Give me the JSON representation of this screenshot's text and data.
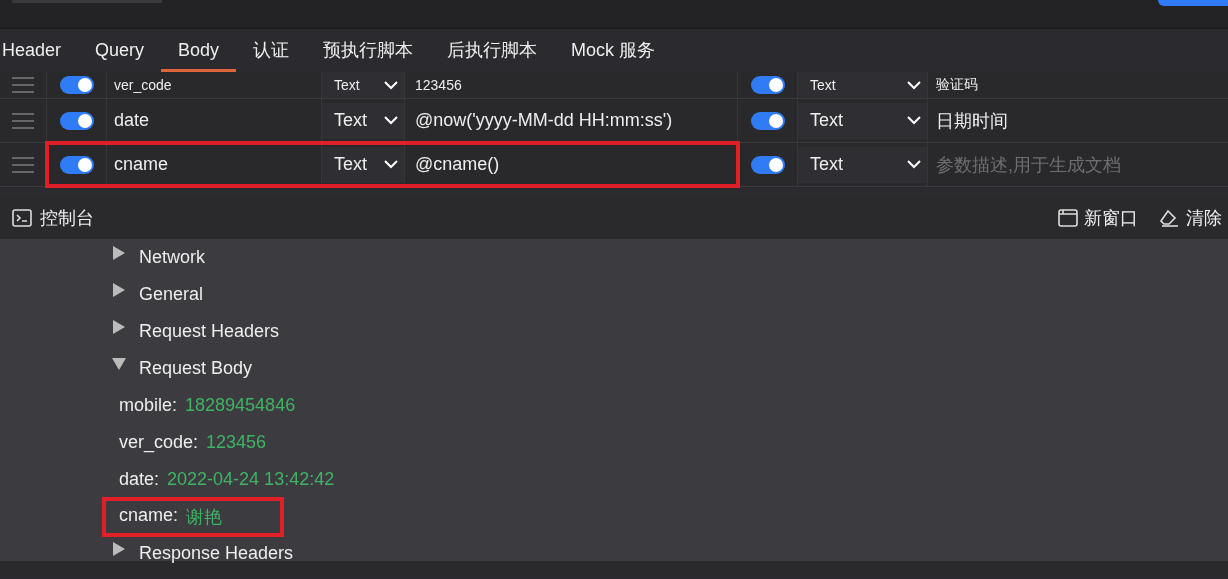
{
  "tabs": [
    {
      "label": "Header",
      "selected": false
    },
    {
      "label": "Query",
      "selected": false
    },
    {
      "label": "Body",
      "selected": true
    },
    {
      "label": "认证",
      "selected": false
    },
    {
      "label": "预执行脚本",
      "selected": false
    },
    {
      "label": "后执行脚本",
      "selected": false
    },
    {
      "label": "Mock 服务",
      "selected": false
    }
  ],
  "params": [
    {
      "enabled": true,
      "name": "ver_code",
      "type": "Text",
      "value": "123456",
      "desc_enabled": true,
      "desc_type": "Text",
      "description": "验证码",
      "partial": true,
      "highlighted": false
    },
    {
      "enabled": true,
      "name": "date",
      "type": "Text",
      "value": "@now('yyyy-MM-dd HH:mm:ss')",
      "desc_enabled": true,
      "desc_type": "Text",
      "description": "日期时间",
      "partial": false,
      "highlighted": false
    },
    {
      "enabled": true,
      "name": "cname",
      "type": "Text",
      "value": "@cname()",
      "desc_enabled": true,
      "desc_type": "Text",
      "placeholder": "参数描述,用于生成文档",
      "partial": false,
      "highlighted": true
    }
  ],
  "console": {
    "title": "控制台",
    "actions": [
      {
        "kind": "window",
        "label": "新窗口"
      },
      {
        "kind": "clear",
        "label": "清除"
      }
    ],
    "entries": [
      {
        "kind": "section",
        "label": "Network",
        "expanded": false
      },
      {
        "kind": "section",
        "label": "General",
        "expanded": false
      },
      {
        "kind": "section",
        "label": "Request Headers",
        "expanded": false
      },
      {
        "kind": "section",
        "label": "Request Body",
        "expanded": true
      },
      {
        "kind": "field",
        "key": "mobile:",
        "value": "18289454846",
        "highlighted": false
      },
      {
        "kind": "field",
        "key": "ver_code:",
        "value": "123456",
        "highlighted": false
      },
      {
        "kind": "field",
        "key": "date:",
        "value": "2022-04-24 13:42:42",
        "highlighted": false
      },
      {
        "kind": "field",
        "key": "cname:",
        "value": "谢艳",
        "highlighted": true
      },
      {
        "kind": "section",
        "label": "Response Headers",
        "expanded": false
      }
    ]
  }
}
